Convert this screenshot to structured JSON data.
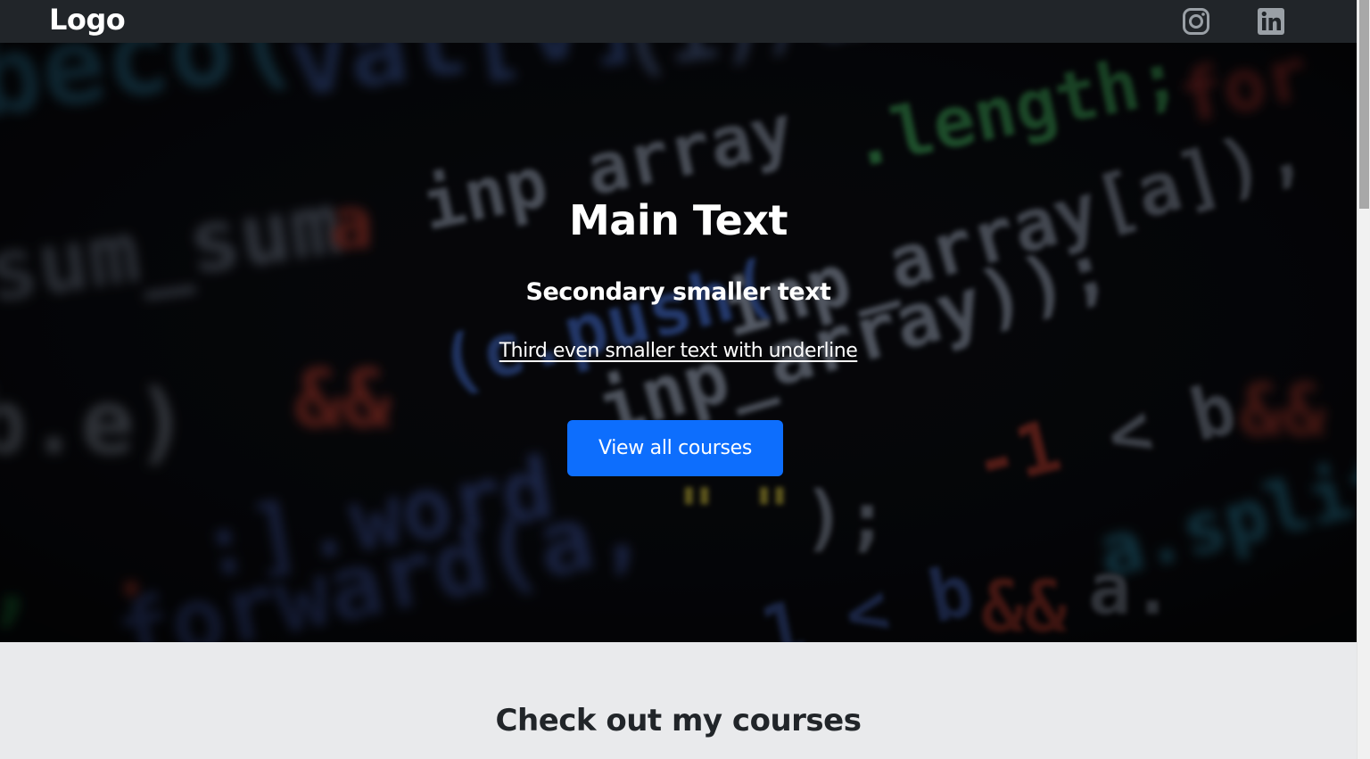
{
  "navbar": {
    "logo": "Logo",
    "social_icons": [
      "instagram-icon",
      "linkedin-icon"
    ],
    "background_color": "#212529",
    "icon_color": "#9aa0a6"
  },
  "hero": {
    "title": "Main Text",
    "subtitle": "Secondary smaller text",
    "link_text": "Third even smaller text with underline",
    "button_label": "View all courses",
    "button_color": "#0d6efd",
    "background_description_icon": "code-background-image"
  },
  "courses": {
    "title": "Check out my courses",
    "background_color": "#e9eaec"
  }
}
